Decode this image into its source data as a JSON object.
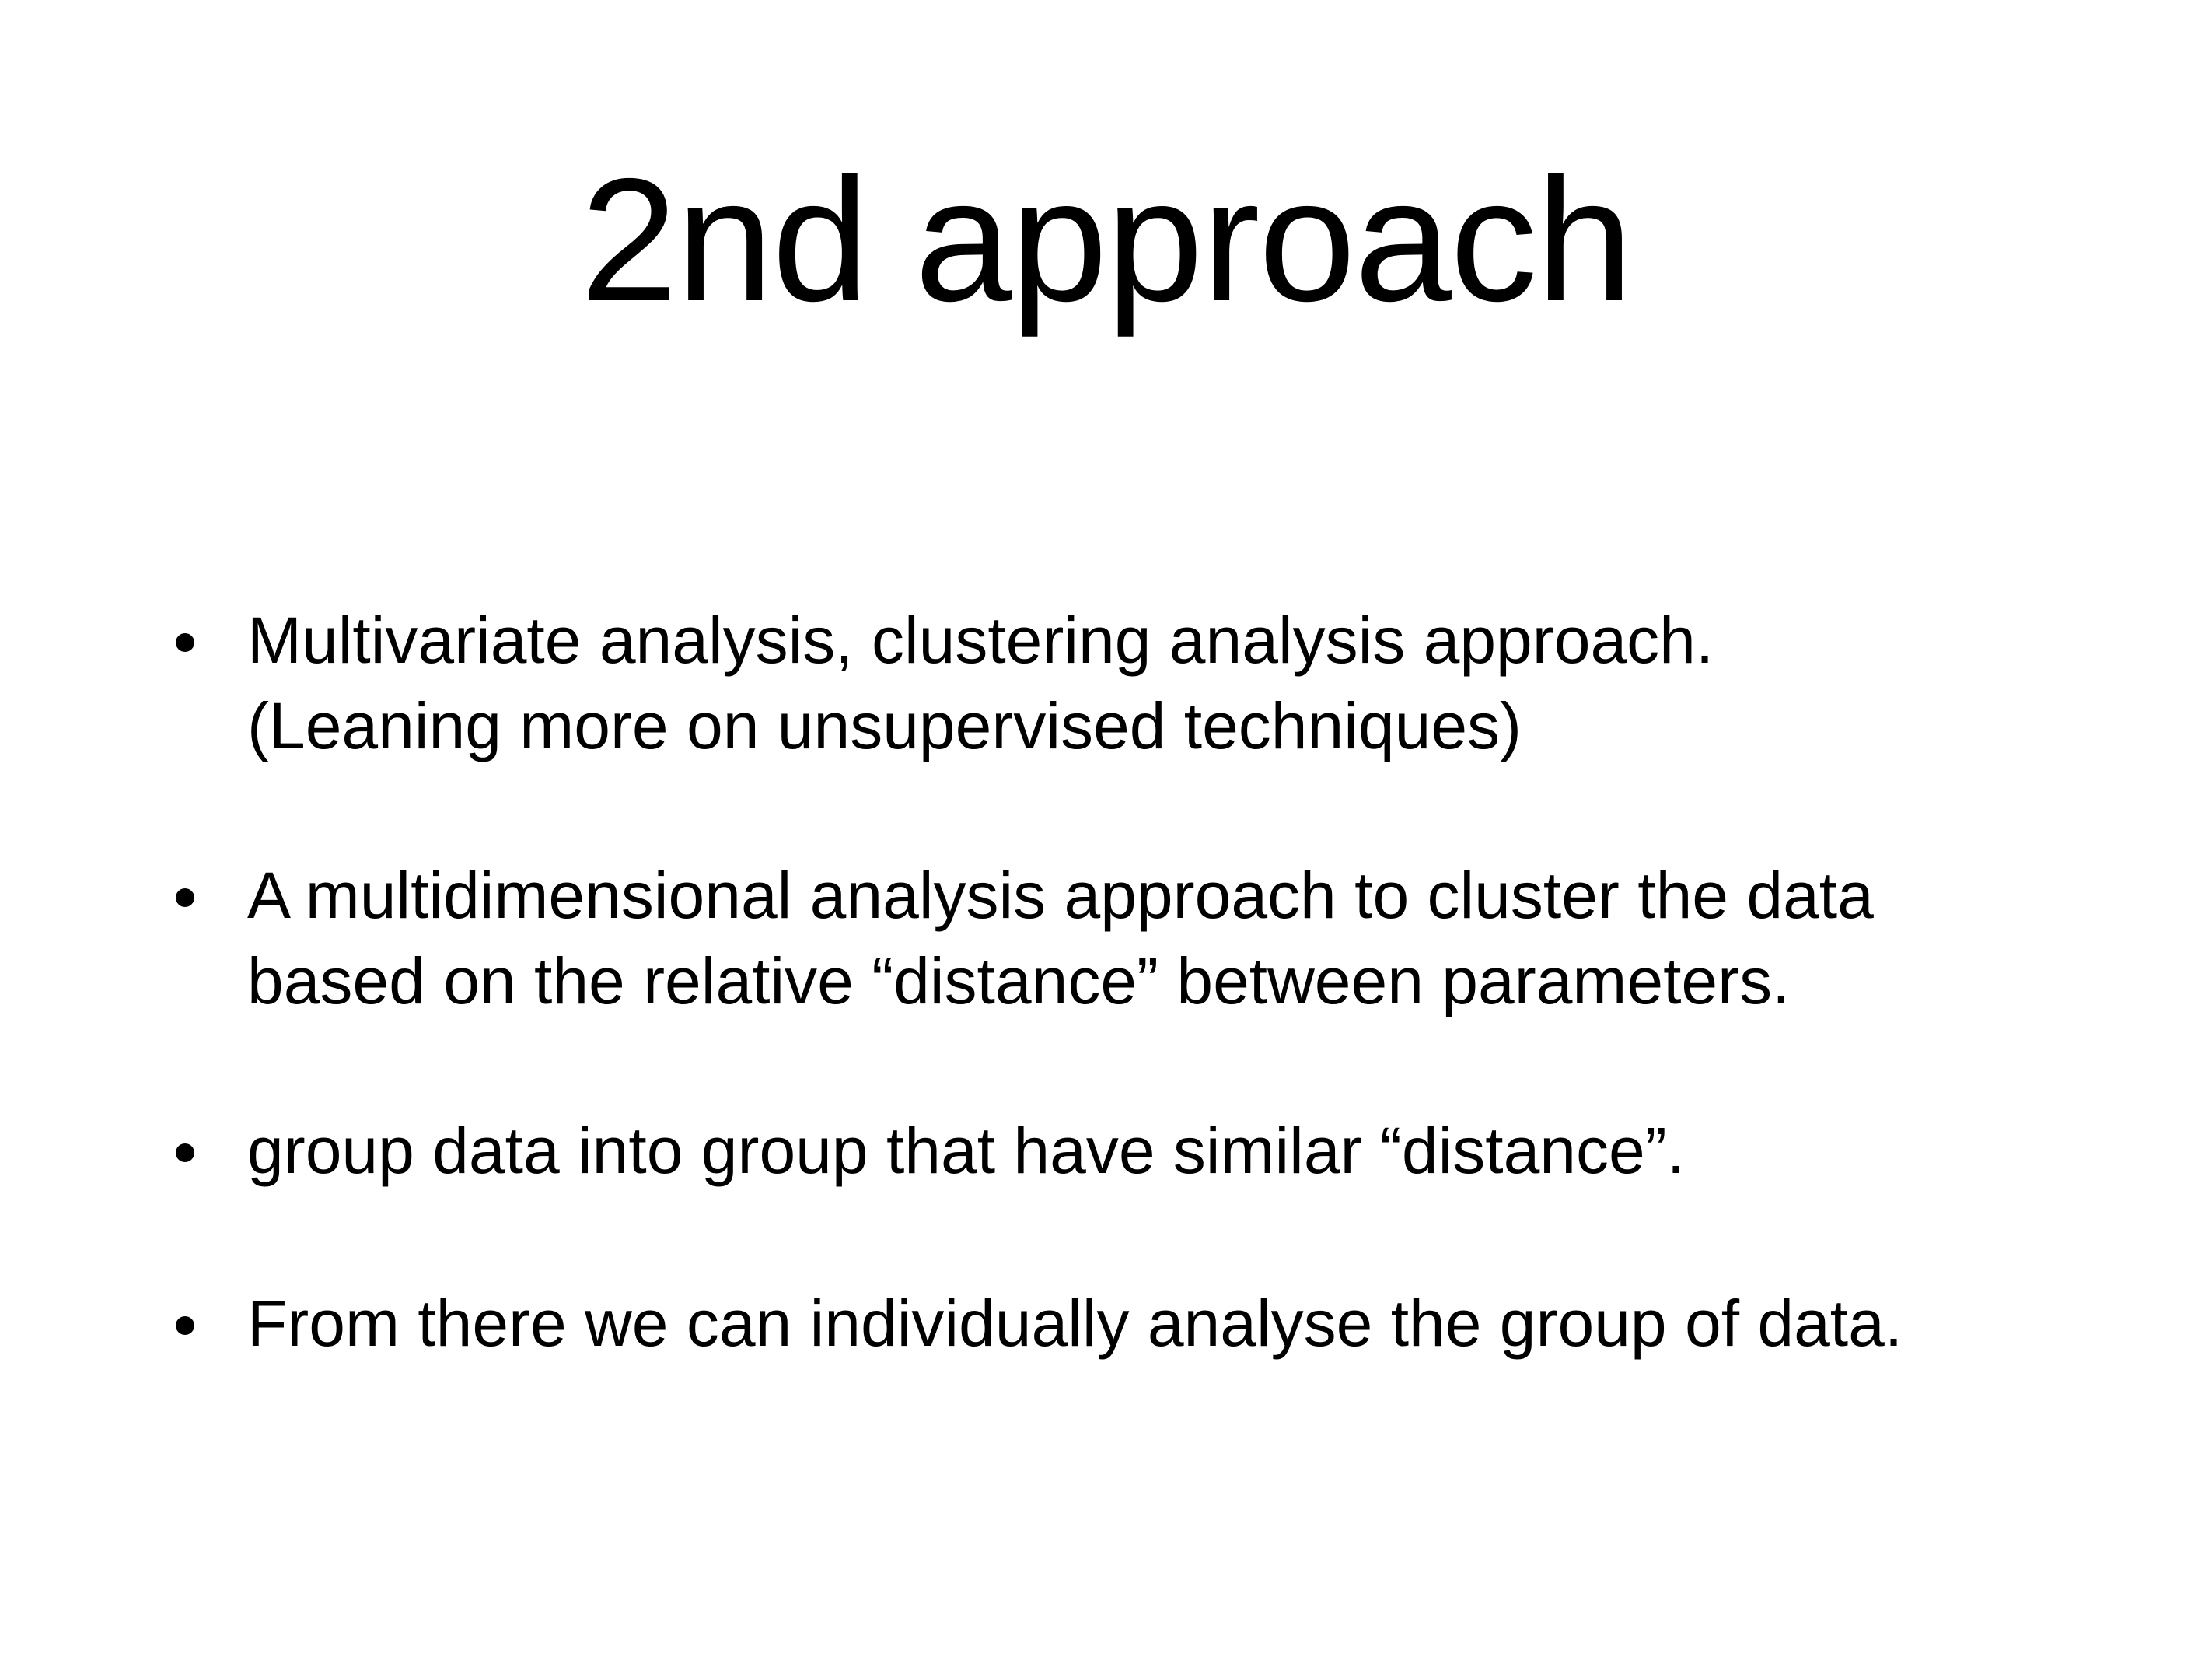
{
  "slide": {
    "title": "2nd approach",
    "bullets": [
      {
        "lines": [
          "Multivariate analysis, clustering analysis approach.",
          "(Leaning more on unsupervised techniques)"
        ]
      },
      {
        "lines": [
          "A multidimensional analysis approach to cluster the data",
          "based on the relative “distance” between parameters."
        ]
      },
      {
        "lines": [
          "group data into group that have similar “distance”."
        ]
      },
      {
        "lines": [
          "From there we can individually analyse the group of data."
        ]
      }
    ]
  }
}
